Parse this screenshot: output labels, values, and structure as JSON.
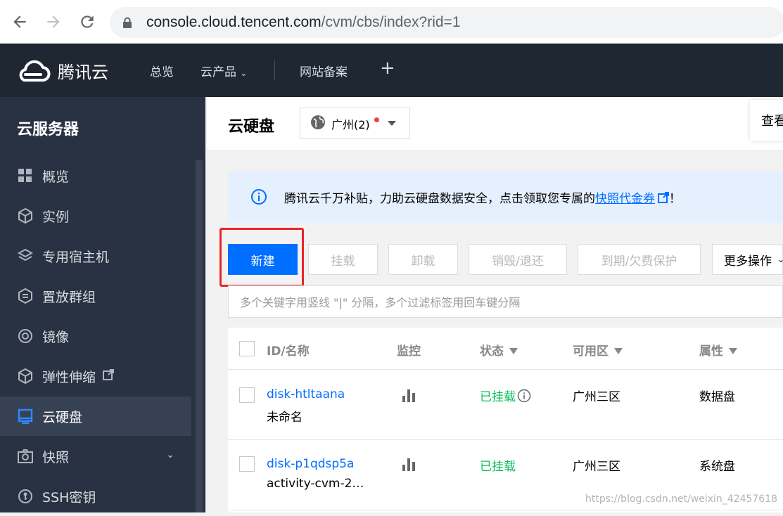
{
  "browser": {
    "url_host": "console.cloud.tencent.com",
    "url_path": "/cvm/cbs/index?rid=1"
  },
  "topnav": {
    "brand": "腾讯云",
    "items": [
      "总览",
      "云产品",
      "网站备案"
    ],
    "plus": "+"
  },
  "sidebar": {
    "title": "云服务器",
    "items": [
      {
        "label": "概览",
        "icon": "grid-icon"
      },
      {
        "label": "实例",
        "icon": "cube-icon"
      },
      {
        "label": "专用宿主机",
        "icon": "layers-icon"
      },
      {
        "label": "置放群组",
        "icon": "hex-group-icon"
      },
      {
        "label": "镜像",
        "icon": "disc-icon"
      },
      {
        "label": "弹性伸缩",
        "icon": "cube-scale-icon"
      },
      {
        "label": "云硬盘",
        "icon": "disk-icon"
      },
      {
        "label": "快照",
        "icon": "camera-icon"
      },
      {
        "label": "SSH密钥",
        "icon": "key-icon"
      }
    ]
  },
  "header": {
    "title": "云硬盘",
    "region": "广州(2)",
    "view": "查看"
  },
  "notice": {
    "text": "腾讯云千万补贴，力助云硬盘数据安全，点击领取您专属的",
    "link": "快照代金券",
    "suffix": "！"
  },
  "toolbar": {
    "new": "新建",
    "mount": "挂载",
    "unmount": "卸载",
    "destroy": "销毁/退还",
    "expiry": "到期/欠费保护",
    "more": "更多操作"
  },
  "search": {
    "placeholder": "多个关键字用竖线 \"|\" 分隔，多个过滤标签用回车键分隔"
  },
  "table": {
    "headers": [
      "ID/名称",
      "监控",
      "状态",
      "可用区",
      "属性"
    ],
    "rows": [
      {
        "id": "disk-htltaana",
        "name": "未命名",
        "status": "已挂载",
        "zone": "广州三区",
        "attr": "数据盘"
      },
      {
        "id": "disk-p1qdsp5a",
        "name": "activity-cvm-2…",
        "status": "已挂载",
        "zone": "广州三区",
        "attr": "系统盘"
      }
    ]
  },
  "watermark": "https://blog.csdn.net/weixin_42457618",
  "colors": {
    "primary": "#006eff",
    "sidebar_bg": "#293242",
    "topnav_bg": "#1f2733",
    "mounted": "#0abf5b",
    "highlight": "#e8262a"
  }
}
